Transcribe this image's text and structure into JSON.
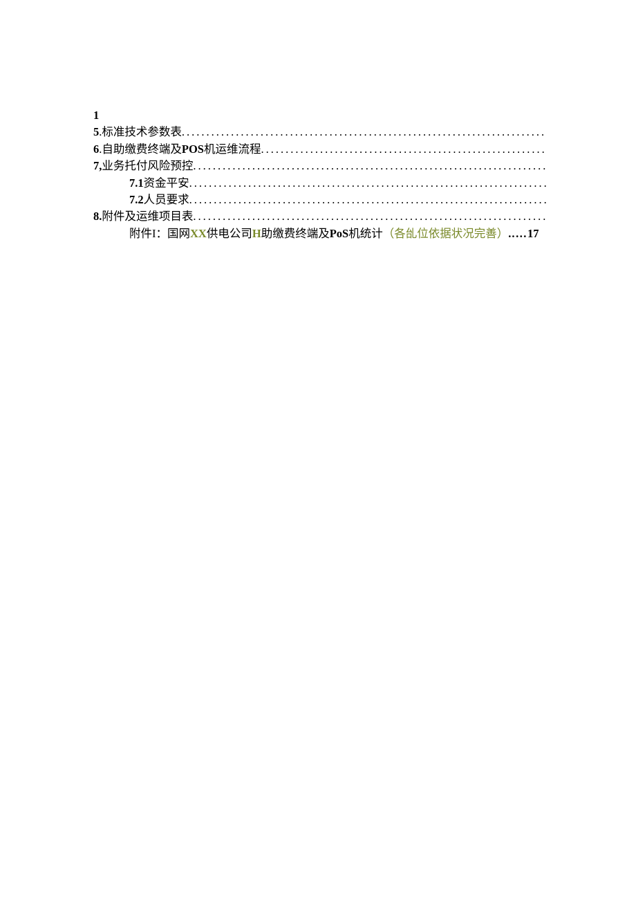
{
  "toc": {
    "line_1_num": "1",
    "item5_num": "5",
    "item5_sep": " .",
    "item5_title": "标准技术参数表",
    "item6_num": "6",
    "item6_sep": " .",
    "item6_title_a": "自助缴费终端及",
    "item6_title_bold": "POS",
    "item6_title_b": "机运维流程",
    "item7_num": "7,",
    "item7_title": "业务托付风险预控 ",
    "item7_1_num": "7.1",
    "item7_1_title": "  资金平安 ",
    "item7_2_num": "7.2",
    "item7_2_title": "  人员要求",
    "item8_num": "8.",
    "item8_title": "附件及运维项目表 ",
    "attach_label": "附件I：",
    "attach_a": "国网",
    "attach_xx": "XX",
    "attach_b": "供电公司",
    "attach_h": "H",
    "attach_c": "助缴费终端及",
    "attach_pos": "PoS",
    "attach_d": "机统计",
    "attach_note": "（各乨位依据状况完善）",
    "attach_dots": "..…",
    "attach_page": "17"
  }
}
